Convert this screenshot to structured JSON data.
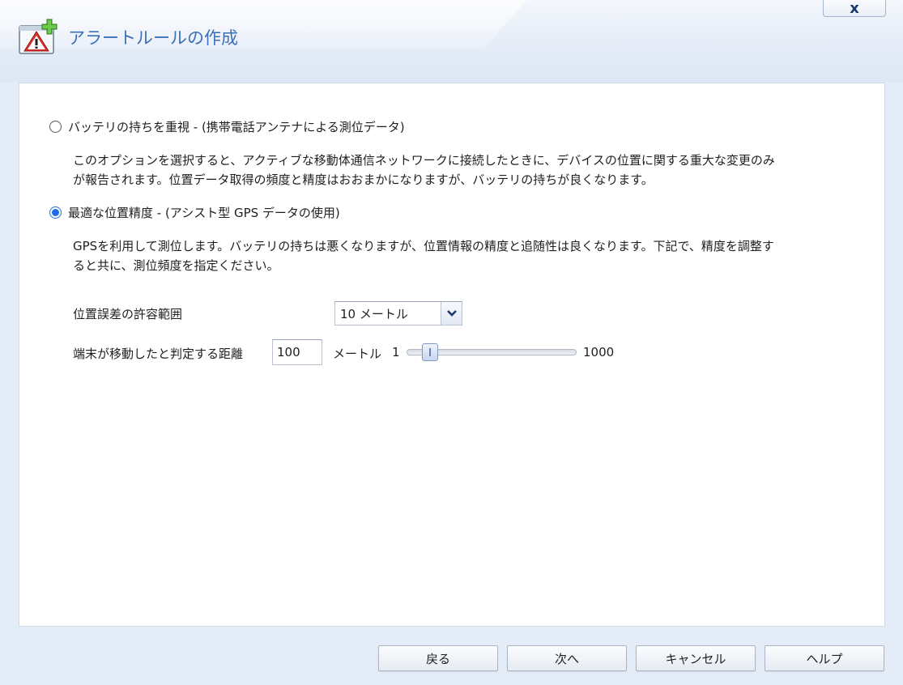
{
  "window": {
    "title": "アラートルールの作成",
    "close_label": "x"
  },
  "options": {
    "battery": {
      "label": "バッテリの持ちを重視 - (携帯電話アンテナによる測位データ)",
      "selected": false,
      "desc_line1": "このオプションを選択すると、アクティブな移動体通信ネットワークに接続したときに、デバイスの位置に関する重大な変更のみ",
      "desc_line2": "が報告されます。位置データ取得の頻度と精度はおおまかになりますが、バッテリの持ちが良くなります。"
    },
    "gps": {
      "label": "最適な位置精度 - (アシスト型 GPS データの使用)",
      "selected": true,
      "desc_line1": "GPSを利用して測位します。バッテリの持ちは悪くなりますが、位置情報の精度と追随性は良くなります。下記で、精度を調整す",
      "desc_line2": "ると共に、測位頻度を指定ください。"
    }
  },
  "fields": {
    "accuracy": {
      "label": "位置誤差の許容範囲",
      "value": "10 メートル"
    },
    "distance": {
      "label": "端末が移動したと判定する距離",
      "value": "100",
      "unit": "メートル",
      "slider_min": "1",
      "slider_max": "1000",
      "slider_value": 100
    }
  },
  "buttons": {
    "back": "戻る",
    "next": "次へ",
    "cancel": "キャンセル",
    "help": "ヘルプ"
  },
  "colors": {
    "title": "#3b6fb6",
    "radio_selected": "#1f6ee8",
    "background": "#e4ecf7"
  },
  "icons": {
    "title": "alert-add-icon",
    "dropdown": "chevron-down-icon"
  }
}
